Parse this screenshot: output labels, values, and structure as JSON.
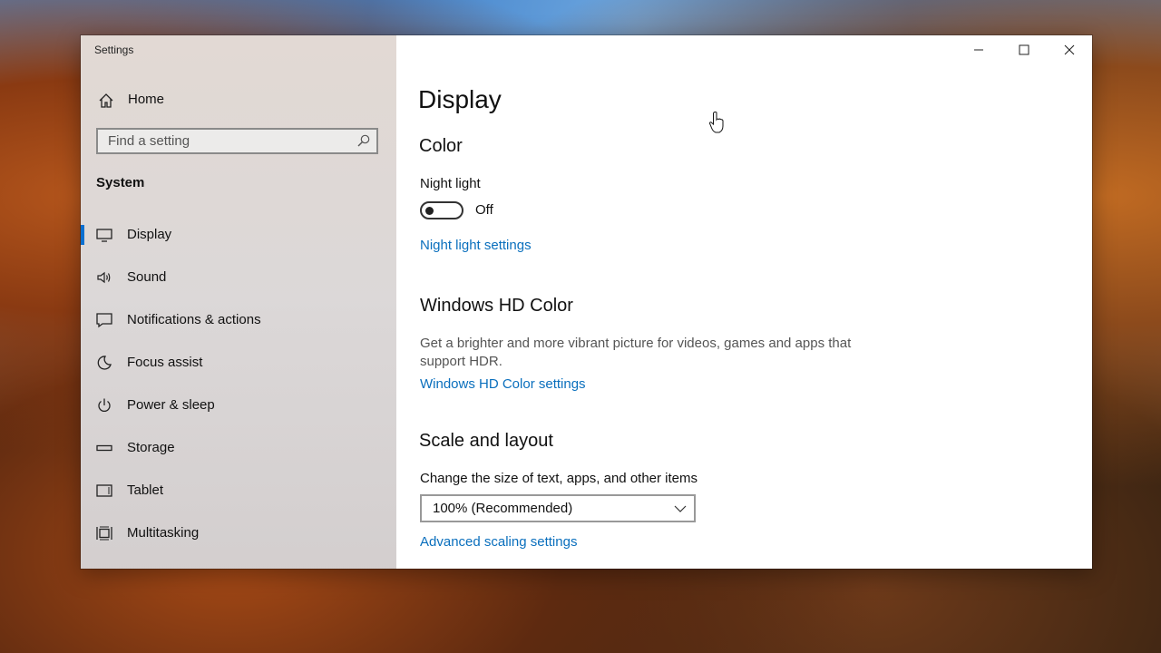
{
  "window": {
    "title": "Settings",
    "controls": {
      "minimize": "minimize-icon",
      "maximize": "maximize-icon",
      "close": "close-icon"
    }
  },
  "sidebar": {
    "home_label": "Home",
    "search_placeholder": "Find a setting",
    "section_title": "System",
    "items": [
      {
        "label": "Display",
        "icon": "monitor-icon",
        "active": true
      },
      {
        "label": "Sound",
        "icon": "speaker-icon",
        "active": false
      },
      {
        "label": "Notifications & actions",
        "icon": "message-icon",
        "active": false
      },
      {
        "label": "Focus assist",
        "icon": "moon-icon",
        "active": false
      },
      {
        "label": "Power & sleep",
        "icon": "power-icon",
        "active": false
      },
      {
        "label": "Storage",
        "icon": "storage-icon",
        "active": false
      },
      {
        "label": "Tablet",
        "icon": "tablet-icon",
        "active": false
      },
      {
        "label": "Multitasking",
        "icon": "multitasking-icon",
        "active": false
      }
    ]
  },
  "main": {
    "page_title": "Display",
    "color": {
      "heading": "Color",
      "night_light_label": "Night light",
      "night_light_state": "Off",
      "night_light_on": false,
      "night_light_link": "Night light settings"
    },
    "hd_color": {
      "heading": "Windows HD Color",
      "description": "Get a brighter and more vibrant picture for videos, games and apps that support HDR.",
      "link": "Windows HD Color settings"
    },
    "scale": {
      "heading": "Scale and layout",
      "label": "Change the size of text, apps, and other items",
      "selected": "100% (Recommended)",
      "link": "Advanced scaling settings"
    }
  },
  "colors": {
    "accent": "#0a6fd0",
    "link": "#0a6fbd"
  }
}
